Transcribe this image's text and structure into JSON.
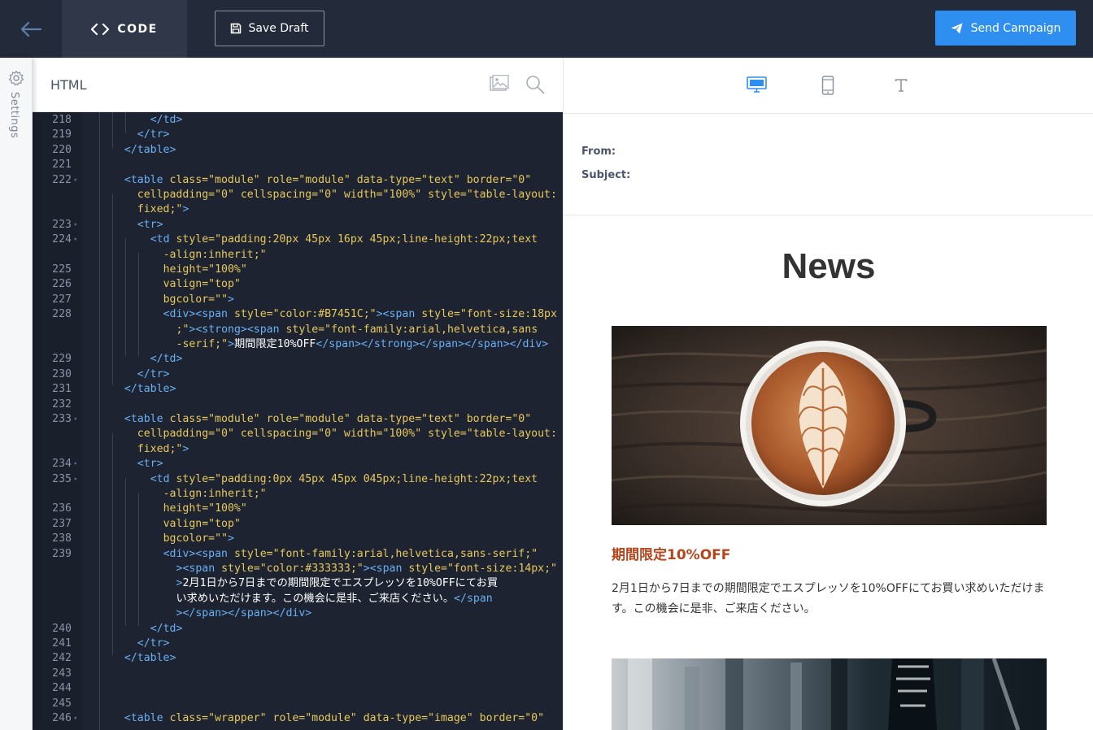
{
  "toolbar": {
    "code_label": "CODE",
    "save_label": "Save Draft",
    "send_label": "Send Campaign",
    "accent": "#2f8ff0"
  },
  "sidebar": {
    "settings_label": "Settings"
  },
  "editor": {
    "title": "HTML",
    "lines": [
      {
        "n": "218",
        "fold": false,
        "segs": [
          [
            "t",
            "</td>"
          ]
        ]
      },
      {
        "n": "219",
        "fold": false,
        "segs": [
          [
            "t",
            "</tr>"
          ]
        ]
      },
      {
        "n": "220",
        "fold": false,
        "segs": [
          [
            "t",
            "</table>"
          ]
        ]
      },
      {
        "n": "221",
        "fold": false,
        "segs": []
      },
      {
        "n": "222",
        "fold": true,
        "segs": [
          [
            "t",
            "<table "
          ],
          [
            "a",
            "class="
          ],
          [
            "s",
            "\"module\" "
          ],
          [
            "a",
            "role="
          ],
          [
            "s",
            "\"module\" "
          ],
          [
            "a",
            "data-type="
          ],
          [
            "s",
            "\"text\" "
          ],
          [
            "a",
            "border="
          ],
          [
            "s",
            "\"0\""
          ]
        ]
      },
      {
        "n": "",
        "fold": false,
        "segs": [
          [
            "a",
            "cellpadding="
          ],
          [
            "s",
            "\"0\" "
          ],
          [
            "a",
            "cellspacing="
          ],
          [
            "s",
            "\"0\" "
          ],
          [
            "a",
            "width="
          ],
          [
            "s",
            "\"100%\" "
          ],
          [
            "a",
            "style="
          ],
          [
            "s",
            "\"table-layout:"
          ]
        ]
      },
      {
        "n": "",
        "fold": false,
        "segs": [
          [
            "s",
            "fixed;\""
          ],
          [
            "t",
            ">"
          ]
        ]
      },
      {
        "n": "223",
        "fold": true,
        "segs": [
          [
            "t",
            "<tr>"
          ]
        ]
      },
      {
        "n": "224",
        "fold": true,
        "segs": [
          [
            "t",
            "<td "
          ],
          [
            "a",
            "style="
          ],
          [
            "s",
            "\"padding:20px 45px 16px 45px;line-height:22px;text"
          ]
        ]
      },
      {
        "n": "",
        "fold": false,
        "segs": [
          [
            "s",
            "-align:inherit;\""
          ]
        ]
      },
      {
        "n": "225",
        "fold": false,
        "segs": [
          [
            "a",
            "height="
          ],
          [
            "s",
            "\"100%\""
          ]
        ]
      },
      {
        "n": "226",
        "fold": false,
        "segs": [
          [
            "a",
            "valign="
          ],
          [
            "s",
            "\"top\""
          ]
        ]
      },
      {
        "n": "227",
        "fold": false,
        "segs": [
          [
            "a",
            "bgcolor="
          ],
          [
            "s",
            "\"\""
          ],
          [
            "t",
            ">"
          ]
        ]
      },
      {
        "n": "228",
        "fold": false,
        "segs": [
          [
            "t",
            "<div><span "
          ],
          [
            "a",
            "style="
          ],
          [
            "s",
            "\"color:#B7451C;\""
          ],
          [
            "t",
            "><span "
          ],
          [
            "a",
            "style="
          ],
          [
            "s",
            "\"font-size:18px"
          ]
        ]
      },
      {
        "n": "",
        "fold": false,
        "segs": [
          [
            "s",
            ";\""
          ],
          [
            "t",
            "><strong><span "
          ],
          [
            "a",
            "style="
          ],
          [
            "s",
            "\"font-family:arial,helvetica,sans"
          ]
        ]
      },
      {
        "n": "",
        "fold": false,
        "segs": [
          [
            "s",
            "-serif;\""
          ],
          [
            "t",
            ">"
          ],
          [
            "w",
            "期間限定10%OFF"
          ],
          [
            "t",
            "</span></strong></span></span></div>"
          ]
        ]
      },
      {
        "n": "229",
        "fold": false,
        "segs": [
          [
            "t",
            "</td>"
          ]
        ]
      },
      {
        "n": "230",
        "fold": false,
        "segs": [
          [
            "t",
            "</tr>"
          ]
        ]
      },
      {
        "n": "231",
        "fold": false,
        "segs": [
          [
            "t",
            "</table>"
          ]
        ]
      },
      {
        "n": "232",
        "fold": false,
        "segs": []
      },
      {
        "n": "233",
        "fold": true,
        "segs": [
          [
            "t",
            "<table "
          ],
          [
            "a",
            "class="
          ],
          [
            "s",
            "\"module\" "
          ],
          [
            "a",
            "role="
          ],
          [
            "s",
            "\"module\" "
          ],
          [
            "a",
            "data-type="
          ],
          [
            "s",
            "\"text\" "
          ],
          [
            "a",
            "border="
          ],
          [
            "s",
            "\"0\""
          ]
        ]
      },
      {
        "n": "",
        "fold": false,
        "segs": [
          [
            "a",
            "cellpadding="
          ],
          [
            "s",
            "\"0\" "
          ],
          [
            "a",
            "cellspacing="
          ],
          [
            "s",
            "\"0\" "
          ],
          [
            "a",
            "width="
          ],
          [
            "s",
            "\"100%\" "
          ],
          [
            "a",
            "style="
          ],
          [
            "s",
            "\"table-layout:"
          ]
        ]
      },
      {
        "n": "",
        "fold": false,
        "segs": [
          [
            "s",
            "fixed;\""
          ],
          [
            "t",
            ">"
          ]
        ]
      },
      {
        "n": "234",
        "fold": true,
        "segs": [
          [
            "t",
            "<tr>"
          ]
        ]
      },
      {
        "n": "235",
        "fold": true,
        "segs": [
          [
            "t",
            "<td "
          ],
          [
            "a",
            "style="
          ],
          [
            "s",
            "\"padding:0px 45px 45px 045px;line-height:22px;text"
          ]
        ]
      },
      {
        "n": "",
        "fold": false,
        "segs": [
          [
            "s",
            "-align:inherit;\""
          ]
        ]
      },
      {
        "n": "236",
        "fold": false,
        "segs": [
          [
            "a",
            "height="
          ],
          [
            "s",
            "\"100%\""
          ]
        ]
      },
      {
        "n": "237",
        "fold": false,
        "segs": [
          [
            "a",
            "valign="
          ],
          [
            "s",
            "\"top\""
          ]
        ]
      },
      {
        "n": "238",
        "fold": false,
        "segs": [
          [
            "a",
            "bgcolor="
          ],
          [
            "s",
            "\"\""
          ],
          [
            "t",
            ">"
          ]
        ]
      },
      {
        "n": "239",
        "fold": false,
        "segs": [
          [
            "t",
            "<div><span "
          ],
          [
            "a",
            "style="
          ],
          [
            "s",
            "\"font-family:arial,helvetica,sans-serif;\""
          ]
        ]
      },
      {
        "n": "",
        "fold": false,
        "segs": [
          [
            "t",
            "><span "
          ],
          [
            "a",
            "style="
          ],
          [
            "s",
            "\"color:#333333;\""
          ],
          [
            "t",
            "><span "
          ],
          [
            "a",
            "style="
          ],
          [
            "s",
            "\"font-size:14px;\""
          ]
        ]
      },
      {
        "n": "",
        "fold": false,
        "segs": [
          [
            "t",
            ">"
          ],
          [
            "w",
            "2月1日から7日までの期間限定でエスプレッソを10%OFFにてお買"
          ]
        ]
      },
      {
        "n": "",
        "fold": false,
        "segs": [
          [
            "w",
            "い求めいただけます。この機会に是非、ご来店ください。"
          ],
          [
            "t",
            "</span"
          ]
        ]
      },
      {
        "n": "",
        "fold": false,
        "segs": [
          [
            "t",
            "></span></span></div>"
          ]
        ]
      },
      {
        "n": "240",
        "fold": false,
        "segs": [
          [
            "t",
            "</td>"
          ]
        ]
      },
      {
        "n": "241",
        "fold": false,
        "segs": [
          [
            "t",
            "</tr>"
          ]
        ]
      },
      {
        "n": "242",
        "fold": false,
        "segs": [
          [
            "t",
            "</table>"
          ]
        ]
      },
      {
        "n": "243",
        "fold": false,
        "segs": []
      },
      {
        "n": "244",
        "fold": false,
        "segs": []
      },
      {
        "n": "245",
        "fold": false,
        "segs": []
      },
      {
        "n": "246",
        "fold": true,
        "segs": [
          [
            "t",
            "<table "
          ],
          [
            "a",
            "class="
          ],
          [
            "s",
            "\"wrapper\" "
          ],
          [
            "a",
            "role="
          ],
          [
            "s",
            "\"module\" "
          ],
          [
            "a",
            "data-type="
          ],
          [
            "s",
            "\"image\" "
          ],
          [
            "a",
            "border="
          ],
          [
            "s",
            "\"0\""
          ]
        ]
      }
    ]
  },
  "preview": {
    "from_label": "From:",
    "subject_label": "Subject:",
    "news_title": "News",
    "offer_heading": "期間限定10%OFF",
    "offer_body": "2月1日から7日までの期間限定でエスプレッソを10%OFFにてお買い求めいただけます。この機会に是非、ご来店ください。",
    "offer_color": "#b7451c"
  }
}
